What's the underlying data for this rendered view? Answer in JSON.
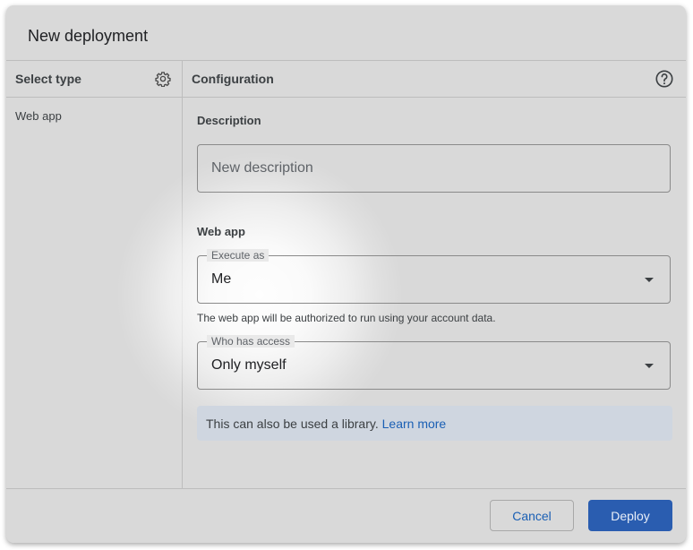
{
  "dialog": {
    "title": "New deployment"
  },
  "left_panel": {
    "header": "Select type",
    "items": [
      {
        "label": "Web app"
      }
    ]
  },
  "right_panel": {
    "header": "Configuration",
    "description": {
      "label": "Description",
      "placeholder": "New description"
    },
    "web_app": {
      "label": "Web app",
      "execute_as": {
        "legend": "Execute as",
        "value": "Me"
      },
      "hint": "The web app will be authorized to run using your account data.",
      "who_has_access": {
        "legend": "Who has access",
        "value": "Only myself"
      }
    },
    "info": {
      "text": "This can also be used a library.",
      "link": "Learn more"
    }
  },
  "footer": {
    "cancel_label": "Cancel",
    "deploy_label": "Deploy"
  },
  "colors": {
    "accent": "#1a5fb4",
    "deploy_button": "#2a5db0",
    "info_background": "#cfd6e0",
    "overlay": "#d9d9d9"
  },
  "icons": {
    "settings": "gear-icon",
    "help": "help-icon",
    "dropdown": "chevron-down-icon"
  }
}
